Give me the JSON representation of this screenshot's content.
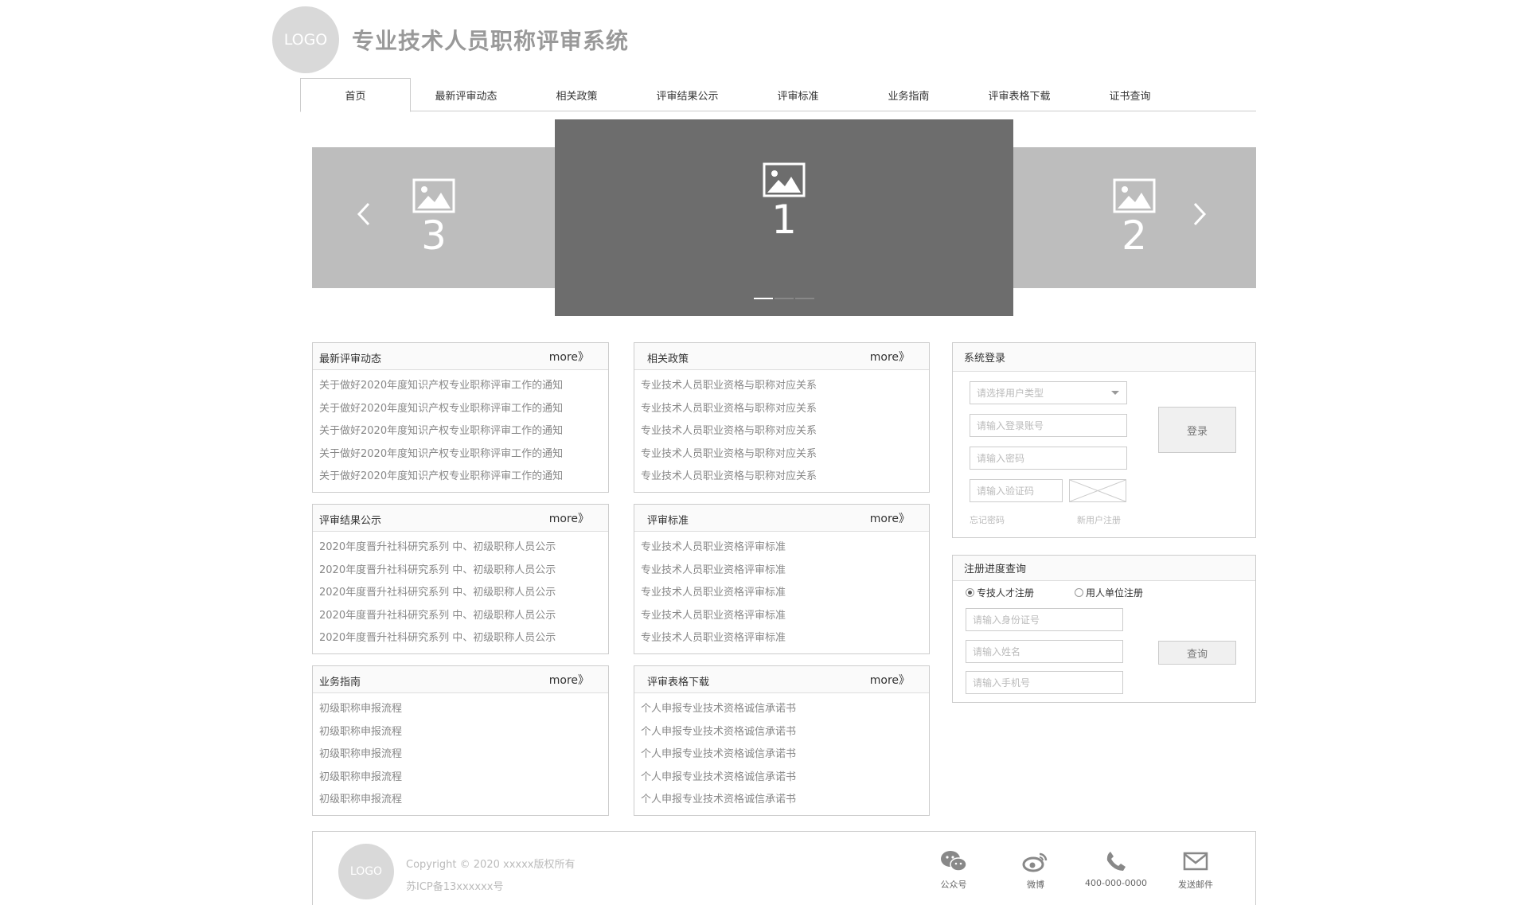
{
  "header": {
    "logo": "LOGO",
    "title": "专业技术人员职称评审系统"
  },
  "nav": {
    "items": [
      {
        "label": "首页",
        "active": true
      },
      {
        "label": "最新评审动态"
      },
      {
        "label": "相关政策"
      },
      {
        "label": "评审结果公示"
      },
      {
        "label": "评审标准"
      },
      {
        "label": "业务指南"
      },
      {
        "label": "评审表格下载"
      },
      {
        "label": "证书查询"
      }
    ]
  },
  "carousel": {
    "left_number": "3",
    "center_number": "1",
    "right_number": "2",
    "prev": "‹",
    "next": "›"
  },
  "panels": {
    "news": {
      "title": "最新评审动态",
      "more": "more》",
      "items": [
        "关于做好2020年度知识产权专业职称评审工作的通知",
        "关于做好2020年度知识产权专业职称评审工作的通知",
        "关于做好2020年度知识产权专业职称评审工作的通知",
        "关于做好2020年度知识产权专业职称评审工作的通知",
        "关于做好2020年度知识产权专业职称评审工作的通知"
      ]
    },
    "policy": {
      "title": "相关政策",
      "more": "more》",
      "items": [
        "专业技术人员职业资格与职称对应关系",
        "专业技术人员职业资格与职称对应关系",
        "专业技术人员职业资格与职称对应关系",
        "专业技术人员职业资格与职称对应关系",
        "专业技术人员职业资格与职称对应关系"
      ]
    },
    "results": {
      "title": "评审结果公示",
      "more": "more》",
      "items": [
        "2020年度晋升社科研究系列 中、初级职称人员公示",
        "2020年度晋升社科研究系列 中、初级职称人员公示",
        "2020年度晋升社科研究系列 中、初级职称人员公示",
        "2020年度晋升社科研究系列 中、初级职称人员公示",
        "2020年度晋升社科研究系列 中、初级职称人员公示"
      ]
    },
    "standards": {
      "title": "评审标准",
      "more": "more》",
      "items": [
        "专业技术人员职业资格评审标准",
        "专业技术人员职业资格评审标准",
        "专业技术人员职业资格评审标准",
        "专业技术人员职业资格评审标准",
        "专业技术人员职业资格评审标准"
      ]
    },
    "guide": {
      "title": "业务指南",
      "more": "more》",
      "items": [
        "初级职称申报流程",
        "初级职称申报流程",
        "初级职称申报流程",
        "初级职称申报流程",
        "初级职称申报流程"
      ]
    },
    "forms": {
      "title": "评审表格下载",
      "more": "more》",
      "items": [
        "个人申报专业技术资格诚信承诺书",
        "个人申报专业技术资格诚信承诺书",
        "个人申报专业技术资格诚信承诺书",
        "个人申报专业技术资格诚信承诺书",
        "个人申报专业技术资格诚信承诺书"
      ]
    }
  },
  "login": {
    "title": "系统登录",
    "user_type_placeholder": "请选择用户类型",
    "account_placeholder": "请输入登录账号",
    "password_placeholder": "请输入密码",
    "captcha_placeholder": "请输入验证码",
    "login_button": "登录",
    "forgot": "忘记密码",
    "register": "新用户注册"
  },
  "progress": {
    "title": "注册进度查询",
    "radio_person": "专技人才注册",
    "radio_unit": "用人单位注册",
    "id_placeholder": "请输入身份证号",
    "name_placeholder": "请输入姓名",
    "phone_placeholder": "请输入手机号",
    "query_button": "查询"
  },
  "footer": {
    "logo": "LOGO",
    "copyright": "Copyright © 2020 xxxxx版权所有",
    "icp": "苏ICP备13xxxxxx号",
    "wechat": "公众号",
    "weibo": "微博",
    "phone": "400-000-0000",
    "email": "发送邮件"
  }
}
